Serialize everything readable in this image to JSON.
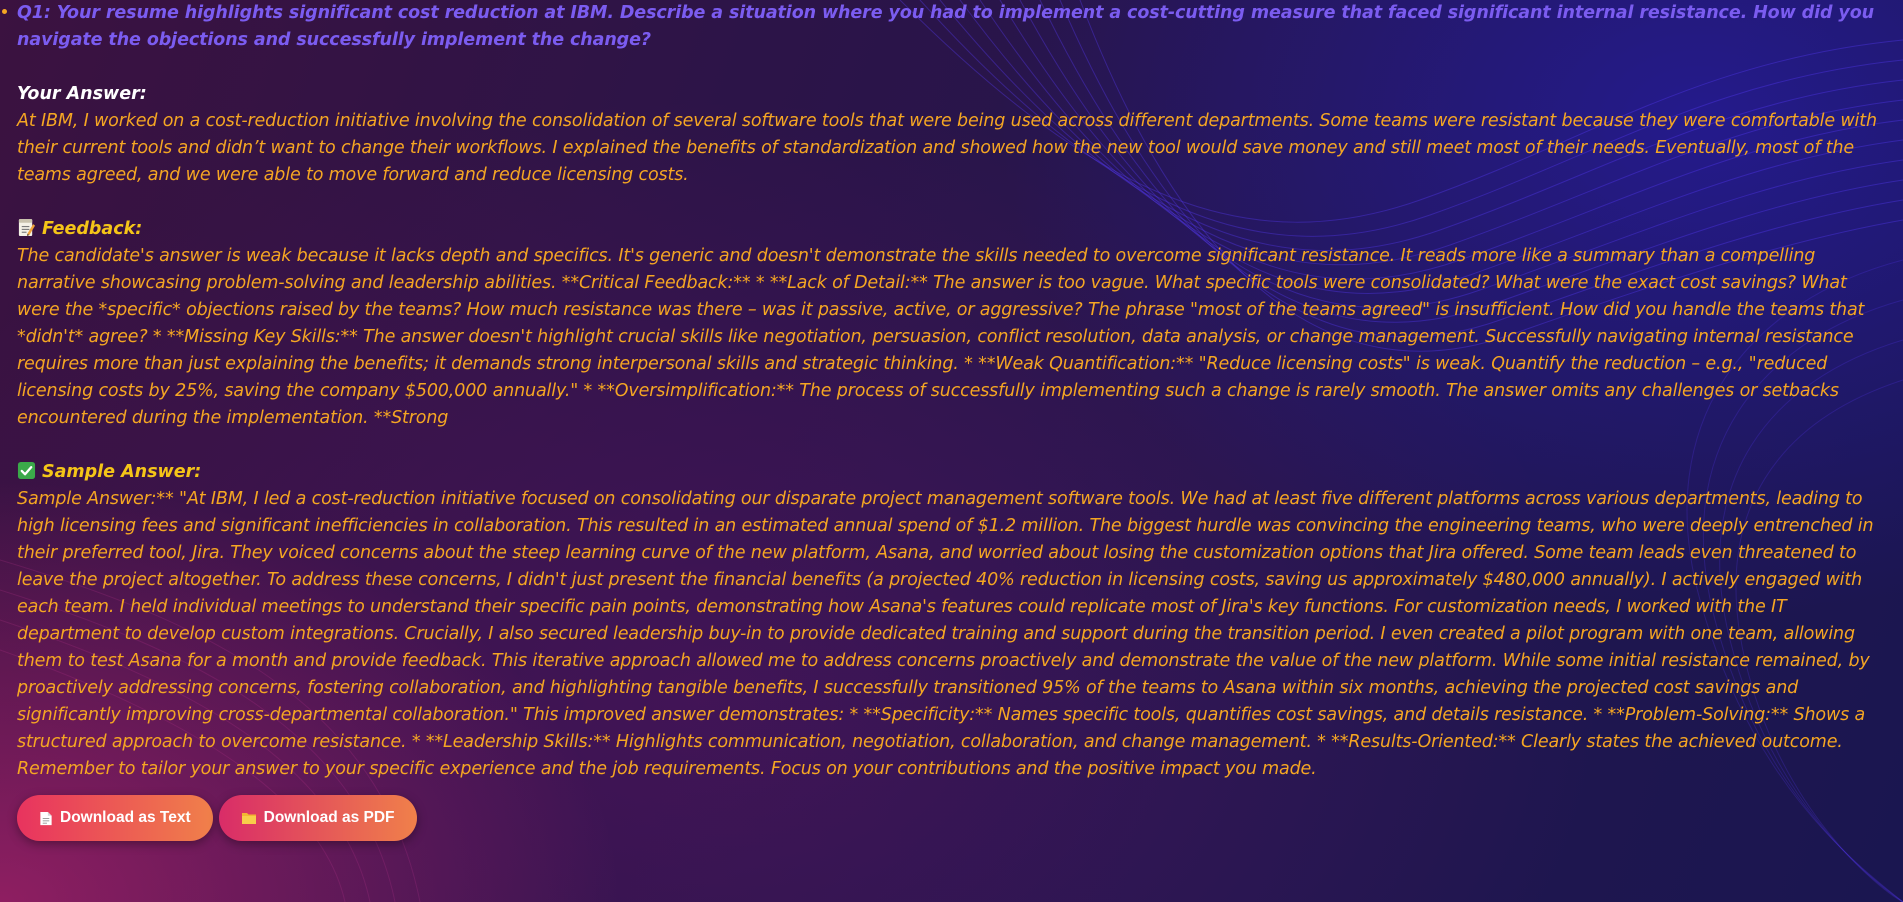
{
  "question": {
    "text": "Q1: Your resume highlights significant cost reduction at IBM. Describe a situation where you had to implement a cost-cutting measure that faced significant internal resistance. How did you navigate the objections and successfully implement the change?"
  },
  "your_answer": {
    "heading": "Your Answer:",
    "text": "At IBM, I worked on a cost-reduction initiative involving the consolidation of several software tools that were being used across different departments. Some teams were resistant because they were comfortable with their current tools and didn’t want to change their workflows. I explained the benefits of standardization and showed how the new tool would save money and still meet most of their needs. Eventually, most of the teams agreed, and we were able to move forward and reduce licensing costs."
  },
  "feedback": {
    "icon": "memo-icon",
    "heading": "Feedback:",
    "text": "The candidate's answer is weak because it lacks depth and specifics. It's generic and doesn't demonstrate the skills needed to overcome significant resistance. It reads more like a summary than a compelling narrative showcasing problem-solving and leadership abilities. **Critical Feedback:** * **Lack of Detail:** The answer is too vague. What specific tools were consolidated? What were the exact cost savings? What were the *specific* objections raised by the teams? How much resistance was there – was it passive, active, or aggressive? The phrase \"most of the teams agreed\" is insufficient. How did you handle the teams that *didn't* agree? * **Missing Key Skills:** The answer doesn't highlight crucial skills like negotiation, persuasion, conflict resolution, data analysis, or change management. Successfully navigating internal resistance requires more than just explaining the benefits; it demands strong interpersonal skills and strategic thinking. * **Weak Quantification:** \"Reduce licensing costs\" is weak. Quantify the reduction – e.g., \"reduced licensing costs by 25%, saving the company $500,000 annually.\" * **Oversimplification:** The process of successfully implementing such a change is rarely smooth. The answer omits any challenges or setbacks encountered during the implementation. **Strong"
  },
  "sample_answer": {
    "icon": "check-mark-icon",
    "heading": "Sample Answer:",
    "text": "Sample Answer:** \"At IBM, I led a cost-reduction initiative focused on consolidating our disparate project management software tools. We had at least five different platforms across various departments, leading to high licensing fees and significant inefficiencies in collaboration. This resulted in an estimated annual spend of $1.2 million. The biggest hurdle was convincing the engineering teams, who were deeply entrenched in their preferred tool, Jira. They voiced concerns about the steep learning curve of the new platform, Asana, and worried about losing the customization options that Jira offered. Some team leads even threatened to leave the project altogether. To address these concerns, I didn't just present the financial benefits (a projected 40% reduction in licensing costs, saving us approximately $480,000 annually). I actively engaged with each team. I held individual meetings to understand their specific pain points, demonstrating how Asana's features could replicate most of Jira's key functions. For customization needs, I worked with the IT department to develop custom integrations. Crucially, I also secured leadership buy-in to provide dedicated training and support during the transition period. I even created a pilot program with one team, allowing them to test Asana for a month and provide feedback. This iterative approach allowed me to address concerns proactively and demonstrate the value of the new platform. While some initial resistance remained, by proactively addressing concerns, fostering collaboration, and highlighting tangible benefits, I successfully transitioned 95% of the teams to Asana within six months, achieving the projected cost savings and significantly improving cross-departmental collaboration.\" This improved answer demonstrates: * **Specificity:** Names specific tools, quantifies cost savings, and details resistance. * **Problem-Solving:** Shows a structured approach to overcome resistance. * **Leadership Skills:** Highlights communication, negotiation, collaboration, and change management. * **Results-Oriented:** Clearly states the achieved outcome. Remember to tailor your answer to your specific experience and the job requirements. Focus on your contributions and the positive impact you made."
  },
  "buttons": {
    "download_text": {
      "icon": "document-icon",
      "label": "Download as Text"
    },
    "download_pdf": {
      "icon": "folder-icon",
      "label": "Download as PDF"
    }
  },
  "colors": {
    "question": "#7b5cf0",
    "body_text": "#f5a623",
    "heading_yellow": "#f5c518",
    "heading_white": "#ffffff"
  }
}
